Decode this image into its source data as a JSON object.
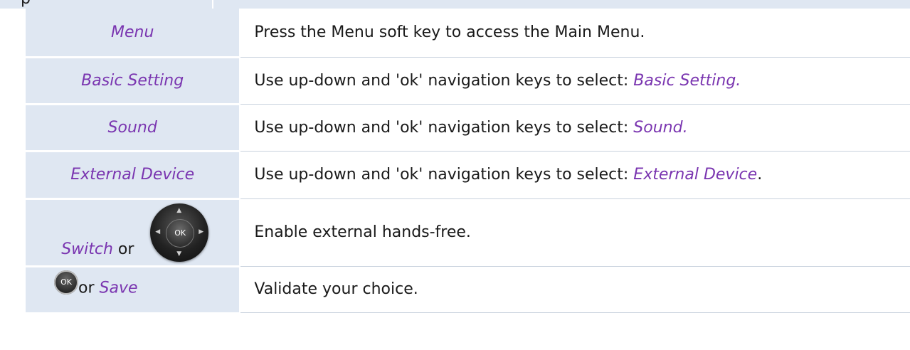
{
  "rows": [
    {
      "action": "Menu",
      "description": "Press the Menu soft key to access the Main Menu."
    },
    {
      "action": "Basic Setting",
      "description_prefix": "Use up-down and 'ok' navigation keys to select: ",
      "description_term": "Basic Setting.",
      "description_suffix": ""
    },
    {
      "action": "Sound",
      "description_prefix": "Use up-down and 'ok' navigation keys to select: ",
      "description_term": "Sound.",
      "description_suffix": ""
    },
    {
      "action": "External Device",
      "description_prefix": "Use up-down and 'ok' navigation keys to select: ",
      "description_term": "External Device",
      "description_suffix": "."
    },
    {
      "action_term": "Switch",
      "action_conj": " or",
      "key_label": "OK",
      "description": "Enable external hands-free."
    },
    {
      "key_label": "OK",
      "action_conj": "or ",
      "action_term": "Save",
      "description": "Validate your choice."
    }
  ],
  "colors": {
    "term": "#7a35b0",
    "cell_bg": "#dfe7f2"
  },
  "icons": {
    "nav_key": "navigation-ok-key-icon",
    "ok_key": "ok-key-icon"
  }
}
